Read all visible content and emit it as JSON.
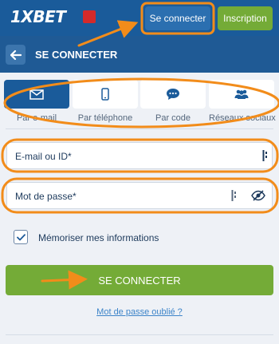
{
  "header": {
    "logo_text": "1XBET",
    "login_label": "Se connecter",
    "register_label": "Inscription"
  },
  "subheader": {
    "title": "SE CONNECTER"
  },
  "tabs": [
    {
      "label": "Par e-mail",
      "icon": "envelope-icon",
      "active": true
    },
    {
      "label": "Par téléphone",
      "icon": "phone-icon",
      "active": false
    },
    {
      "label": "Par code",
      "icon": "chat-bubble-icon",
      "active": false
    },
    {
      "label": "Réseaux sociaux",
      "icon": "users-icon",
      "active": false
    }
  ],
  "form": {
    "email_label": "E-mail ou ID*",
    "password_label": "Mot de passe*",
    "remember_label": "Mémoriser mes informations",
    "remember_checked": true,
    "submit_label": "SE CONNECTER",
    "forgot_label": "Mot de passe oublié ?"
  },
  "colors": {
    "header_bg": "#1a5b9a",
    "accent_green": "#74ab37",
    "highlight_orange": "#f28c1a"
  }
}
